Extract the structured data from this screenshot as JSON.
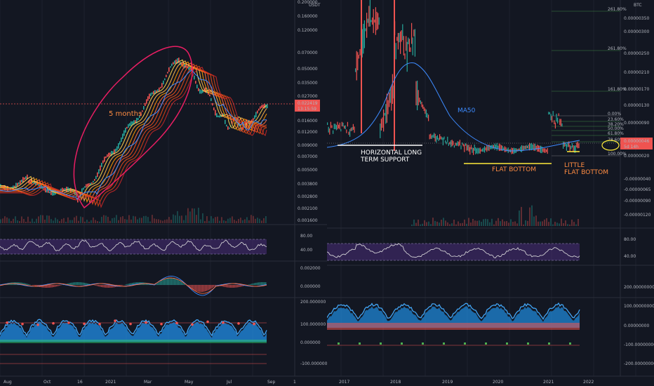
{
  "left_chart": {
    "currency": "USDT",
    "price_axis": [
      "0.200000",
      "0.160000",
      "0.120000",
      "0.070000",
      "0.050000",
      "0.035000",
      "0.027000",
      "0.016000",
      "0.012000",
      "0.009000",
      "0.007000",
      "0.005000",
      "0.003800",
      "0.002800",
      "0.002100",
      "0.001600"
    ],
    "rsi_axis": [
      "80.00",
      "40.00"
    ],
    "macd_axis": [
      "0.002000",
      "0.000000"
    ],
    "osc_axis": [
      "200.000000",
      "100.000000",
      "0.000000",
      "-100.000000"
    ],
    "time_axis": [
      "Aug",
      "Oct",
      "16",
      "2021",
      "Mar",
      "May",
      "Jul",
      "Sep",
      "1"
    ],
    "current_price": "0.022419",
    "countdown": "13:15:59",
    "annotation": "5 months",
    "annotation_color": "#ff8c42",
    "circle_color": "#e91e63"
  },
  "right_chart": {
    "currency": "BTC",
    "price_axis": [
      "0.00000350",
      "0.00000300",
      "0.00000250",
      "0.00000210",
      "0.00000170",
      "0.00000130",
      "0.00000090",
      "0.00000020",
      "-0.00000040",
      "-0.00000065",
      "-0.00000090",
      "-0.00000120"
    ],
    "fib_levels": [
      "261.80%",
      "261.80%",
      "161.80%",
      "0.00%",
      "23.60%",
      "38.20%",
      "50.00%",
      "61.80%",
      "78.60%",
      "100.00%"
    ],
    "current_price": "0.00000046",
    "countdown": "5d 14h",
    "rsi_axis": [
      "80.00",
      "40.00"
    ],
    "osc_axis": [
      "200.00000000",
      "100.00000000",
      "0.00000000",
      "-100.00000000",
      "-200.00000000"
    ],
    "time_axis": [
      "2017",
      "2018",
      "2019",
      "2020",
      "2021",
      "2022"
    ],
    "labels": {
      "ma": "MA50",
      "support": "HORIZONTAL LONG\nTERM SUPPORT",
      "flat": "FLAT BOTTOM",
      "little": "LITTLE\nFLAT BOTTOM"
    },
    "colors": {
      "ma": "#3d8bff",
      "orange": "#ff8c42",
      "white": "#ffffff",
      "yellow": "#ffeb3b"
    }
  }
}
